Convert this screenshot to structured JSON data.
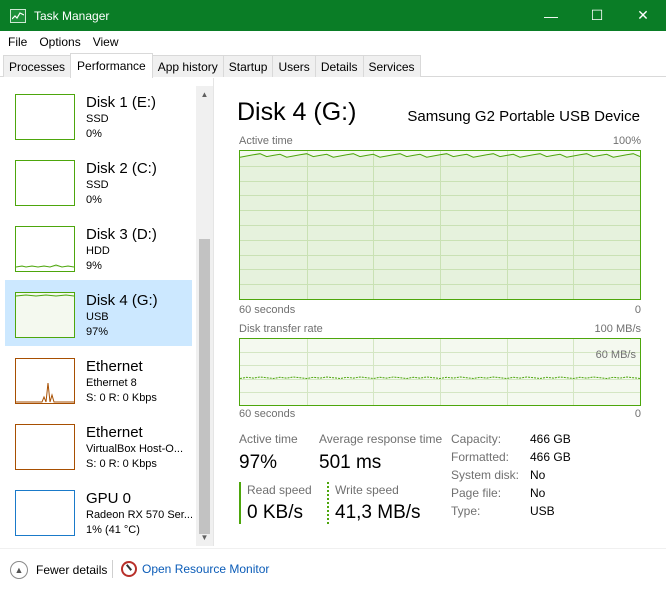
{
  "window": {
    "title": "Task Manager",
    "minimize_glyph": "—",
    "maximize_glyph": "☐",
    "close_glyph": "✕",
    "accent": "#0a7d26"
  },
  "menu": [
    "File",
    "Options",
    "View"
  ],
  "tabs": [
    "Processes",
    "Performance",
    "App history",
    "Startup",
    "Users",
    "Details",
    "Services"
  ],
  "active_tab": "Performance",
  "devices": [
    {
      "name": "Disk 1 (E:)",
      "sub": "SSD",
      "value": "0%",
      "kind": "disk"
    },
    {
      "name": "Disk 2 (C:)",
      "sub": "SSD",
      "value": "0%",
      "kind": "disk"
    },
    {
      "name": "Disk 3 (D:)",
      "sub": "HDD",
      "value": "9%",
      "kind": "disk"
    },
    {
      "name": "Disk 4 (G:)",
      "sub": "USB",
      "value": "97%",
      "kind": "disk",
      "selected": true
    },
    {
      "name": "Ethernet",
      "sub": "Ethernet 8",
      "value": "S: 0 R: 0 Kbps",
      "kind": "eth"
    },
    {
      "name": "Ethernet",
      "sub": "VirtualBox Host-O...",
      "value": "S: 0 R: 0 Kbps",
      "kind": "eth"
    },
    {
      "name": "GPU 0",
      "sub": "Radeon RX 570 Ser...",
      "value": "1% (41 °C)",
      "kind": "gpu"
    }
  ],
  "detail": {
    "title": "Disk 4 (G:)",
    "model": "Samsung G2 Portable USB Device",
    "active_graph": {
      "label": "Active time",
      "max_label": "100%",
      "x_label": "60 seconds",
      "min_label": "0",
      "level": 0.97
    },
    "transfer_graph": {
      "label": "Disk transfer rate",
      "max_label": "100 MB/s",
      "inner_label": "60 MB/s",
      "x_label": "60 seconds",
      "min_label": "0",
      "level": 0.413
    },
    "stats": {
      "active_time_label": "Active time",
      "active_time_value": "97%",
      "response_label": "Average response time",
      "response_value": "501 ms",
      "read_label": "Read speed",
      "read_value": "0 KB/s",
      "write_label": "Write speed",
      "write_value": "41,3 MB/s"
    },
    "properties": [
      {
        "key": "Capacity:",
        "value": "466 GB"
      },
      {
        "key": "Formatted:",
        "value": "466 GB"
      },
      {
        "key": "System disk:",
        "value": "No"
      },
      {
        "key": "Page file:",
        "value": "No"
      },
      {
        "key": "Type:",
        "value": "USB"
      }
    ]
  },
  "footer": {
    "fewer_details": "Fewer details",
    "resource_monitor": "Open Resource Monitor"
  }
}
